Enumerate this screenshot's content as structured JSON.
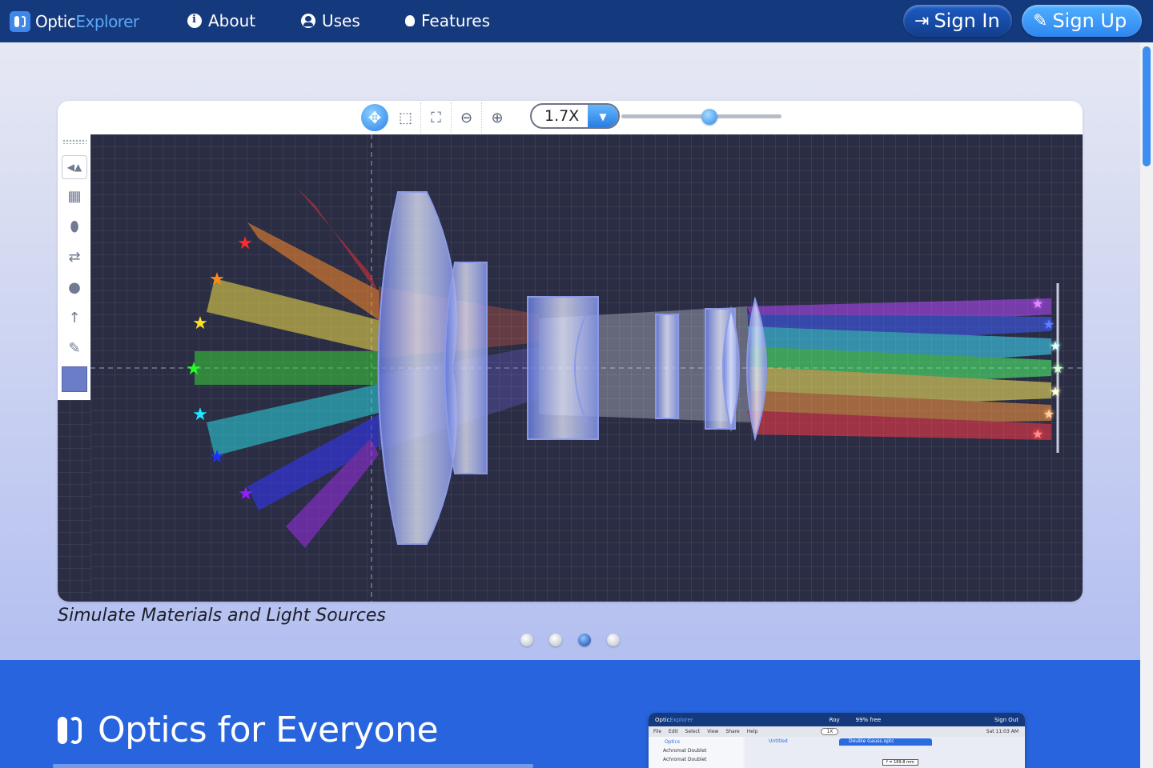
{
  "nav": {
    "logo_part1": "Optic",
    "logo_part2": "Explorer",
    "links": [
      {
        "label": "About",
        "icon": "info-circle-icon"
      },
      {
        "label": "Uses",
        "icon": "user-circle-icon"
      },
      {
        "label": "Features",
        "icon": "lightbulb-icon"
      }
    ],
    "sign_in": "Sign In",
    "sign_up": "Sign Up"
  },
  "toolbar": {
    "zoom_value": "1.7X",
    "zoom_slider_fraction": 0.55
  },
  "slideshow": {
    "caption": "Simulate Materials and Light Sources",
    "slide_count": 4,
    "active_index": 2
  },
  "section": {
    "title": "Optics for Everyone"
  },
  "preview": {
    "app_part1": "Optic",
    "app_part2": "Explorer",
    "user": "Roy",
    "free": "99% free",
    "signout": "Sign Out",
    "date": "Sat 11:03 AM",
    "menu": [
      "File",
      "Edit",
      "Select",
      "View",
      "Share",
      "Help"
    ],
    "zoom": "1X",
    "sidebar_header": "Optics",
    "sidebar_items": [
      "Achromat Doublet",
      "Achromat Doublet"
    ],
    "untitled": "Untitled",
    "tab": "Double Gauss.optc",
    "focal": "f = 169.8 mm"
  },
  "colors": {
    "nav_bg": "#15397d",
    "accent": "#2f86ef",
    "section_bg": "#2764dd",
    "canvas_bg": "#2a2d43"
  }
}
